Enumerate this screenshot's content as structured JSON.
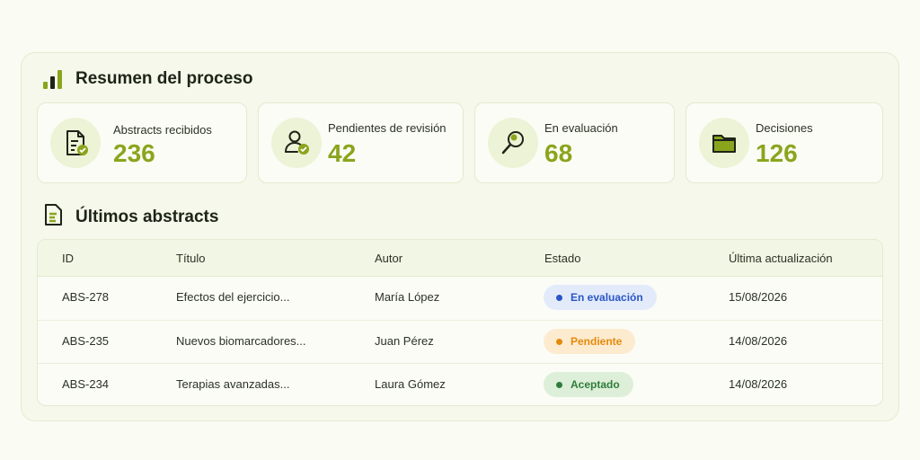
{
  "summary": {
    "title": "Resumen del proceso",
    "cards": [
      {
        "label": "Abstracts recibidos",
        "value": "236",
        "icon": "document-check-icon"
      },
      {
        "label": "Pendientes de revisión",
        "value": "42",
        "icon": "user-check-icon"
      },
      {
        "label": "En evaluación",
        "value": "68",
        "icon": "magnifier-icon"
      },
      {
        "label": "Decisiones",
        "value": "126",
        "icon": "folder-icon"
      }
    ]
  },
  "recent": {
    "title": "Últimos abstracts",
    "columns": {
      "id": "ID",
      "title": "Título",
      "author": "Autor",
      "state": "Estado",
      "date": "Última actualización"
    },
    "rows": [
      {
        "id": "ABS-278",
        "title": "Efectos del ejercicio...",
        "author": "María López",
        "state": "En evaluación",
        "date": "15/08/2026"
      },
      {
        "id": "ABS-235",
        "title": "Nuevos biomarcadores...",
        "author": "Juan Pérez",
        "state": "Pendiente",
        "date": "14/08/2026"
      },
      {
        "id": "ABS-234",
        "title": "Terapias avanzadas...",
        "author": "Laura Gómez",
        "state": "Aceptado",
        "date": "14/08/2026"
      }
    ]
  },
  "colors": {
    "accent": "#8aa51d",
    "status_evaluation_bg": "#e3ebfb",
    "status_evaluation_fg": "#2a56c6",
    "status_pending_bg": "#fdebd0",
    "status_pending_fg": "#e58a0b",
    "status_accepted_bg": "#ddefd8",
    "status_accepted_fg": "#2f7d3a"
  }
}
